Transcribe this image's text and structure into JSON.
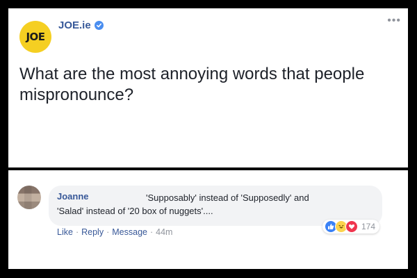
{
  "post": {
    "page_name": "JOE.ie",
    "avatar_text": "JOE",
    "text": "What are the most annoying words that people mispronounce?",
    "more_icon": "more-dots-icon"
  },
  "comment": {
    "author": "Joanne",
    "text": "'Supposably' instead of 'Supposedly' and\n'Salad' instead of '20 box of nuggets'....",
    "actions": {
      "like": "Like",
      "reply": "Reply",
      "message": "Message",
      "time": "44m",
      "separator": "·"
    },
    "reactions": {
      "count": "174",
      "types": [
        "like",
        "haha",
        "love"
      ]
    }
  },
  "colors": {
    "brand_link": "#385898",
    "joe_yellow": "#f5cf22",
    "verified_blue": "#4a8ef0",
    "like_blue": "#3b82f6",
    "haha_yellow": "#fcd34d",
    "love_red": "#f0354e"
  }
}
